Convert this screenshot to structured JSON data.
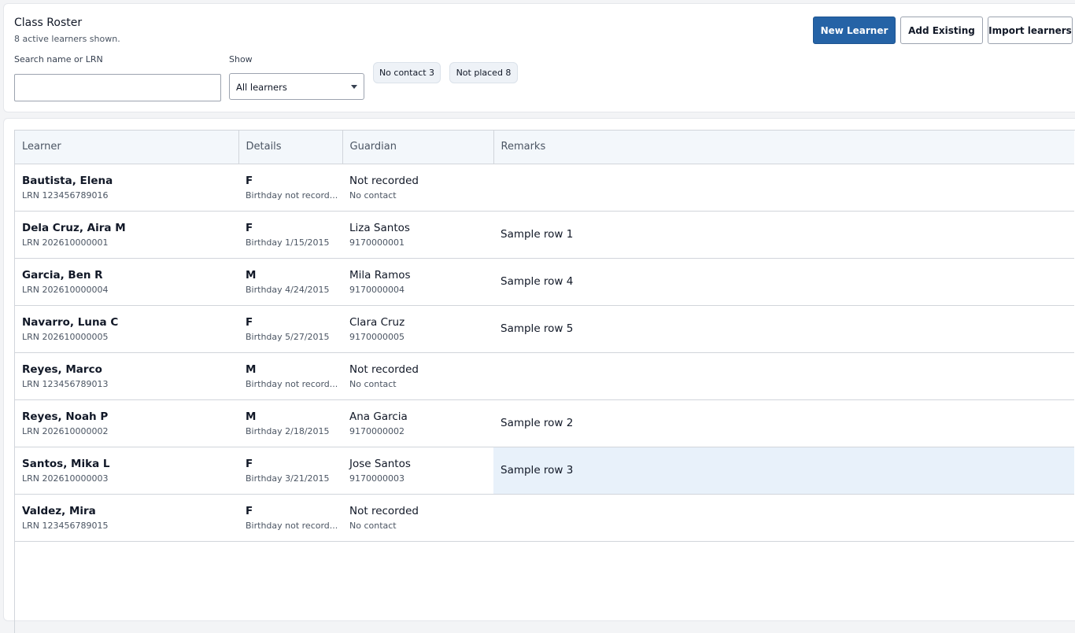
{
  "header": {
    "title": "Class Roster",
    "subtitle": "8 active learners shown."
  },
  "filters": {
    "search_label": "Search name or LRN",
    "search_value": "",
    "show_label": "Show",
    "show_selected": "All learners",
    "chips": [
      {
        "label": "No contact 3"
      },
      {
        "label": "Not placed 8"
      }
    ]
  },
  "actions": {
    "new_learner": "New Learner",
    "add_existing": "Add Existing",
    "import_learners": "Import learners"
  },
  "table": {
    "columns": [
      "Learner",
      "Details",
      "Guardian",
      "Remarks"
    ],
    "rows": [
      {
        "name": "Bautista, Elena",
        "lrn": "LRN 123456789016",
        "sex": "F",
        "birthday": "Birthday not record...",
        "guardian": "Not recorded",
        "contact": "No contact",
        "remarks": ""
      },
      {
        "name": "Dela Cruz, Aira M",
        "lrn": "LRN 202610000001",
        "sex": "F",
        "birthday": "Birthday 1/15/2015",
        "guardian": "Liza Santos",
        "contact": "9170000001",
        "remarks": "Sample row 1"
      },
      {
        "name": "Garcia, Ben R",
        "lrn": "LRN 202610000004",
        "sex": "M",
        "birthday": "Birthday 4/24/2015",
        "guardian": "Mila Ramos",
        "contact": "9170000004",
        "remarks": "Sample row 4"
      },
      {
        "name": "Navarro, Luna C",
        "lrn": "LRN 202610000005",
        "sex": "F",
        "birthday": "Birthday 5/27/2015",
        "guardian": "Clara Cruz",
        "contact": "9170000005",
        "remarks": "Sample row 5"
      },
      {
        "name": "Reyes, Marco",
        "lrn": "LRN 123456789013",
        "sex": "M",
        "birthday": "Birthday not record...",
        "guardian": "Not recorded",
        "contact": "No contact",
        "remarks": ""
      },
      {
        "name": "Reyes, Noah P",
        "lrn": "LRN 202610000002",
        "sex": "M",
        "birthday": "Birthday 2/18/2015",
        "guardian": "Ana Garcia",
        "contact": "9170000002",
        "remarks": "Sample row 2"
      },
      {
        "name": "Santos, Mika L",
        "lrn": "LRN 202610000003",
        "sex": "F",
        "birthday": "Birthday 3/21/2015",
        "guardian": "Jose Santos",
        "contact": "9170000003",
        "remarks": "Sample row 3"
      },
      {
        "name": "Valdez, Mira",
        "lrn": "LRN 123456789015",
        "sex": "F",
        "birthday": "Birthday not record...",
        "guardian": "Not recorded",
        "contact": "No contact",
        "remarks": ""
      }
    ]
  },
  "colors": {
    "primary_button": "#2563a6",
    "selected_cell": "#e8f1fa",
    "header_bg": "#f3f7fb"
  }
}
